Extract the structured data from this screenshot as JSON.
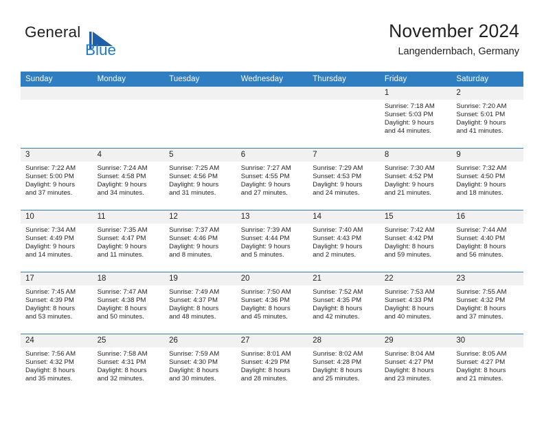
{
  "brand": {
    "name_part1": "General",
    "name_part2": "Blue",
    "mark_icon": "blue-triangle-flag-icon",
    "accent_color": "#1f7cc4"
  },
  "header": {
    "title": "November 2024",
    "subtitle": "Langendernbach, Germany"
  },
  "theme": {
    "header_row_color": "#2f7ec1",
    "daynum_band_color": "#f1f1f1",
    "text_color": "#231f20"
  },
  "calendar": {
    "weekday_headers": [
      "Sunday",
      "Monday",
      "Tuesday",
      "Wednesday",
      "Thursday",
      "Friday",
      "Saturday"
    ],
    "weeks": [
      [
        {
          "day": "",
          "lines": []
        },
        {
          "day": "",
          "lines": []
        },
        {
          "day": "",
          "lines": []
        },
        {
          "day": "",
          "lines": []
        },
        {
          "day": "",
          "lines": []
        },
        {
          "day": "1",
          "lines": [
            "Sunrise: 7:18 AM",
            "Sunset: 5:03 PM",
            "Daylight: 9 hours",
            "and 44 minutes."
          ]
        },
        {
          "day": "2",
          "lines": [
            "Sunrise: 7:20 AM",
            "Sunset: 5:01 PM",
            "Daylight: 9 hours",
            "and 41 minutes."
          ]
        }
      ],
      [
        {
          "day": "3",
          "lines": [
            "Sunrise: 7:22 AM",
            "Sunset: 5:00 PM",
            "Daylight: 9 hours",
            "and 37 minutes."
          ]
        },
        {
          "day": "4",
          "lines": [
            "Sunrise: 7:24 AM",
            "Sunset: 4:58 PM",
            "Daylight: 9 hours",
            "and 34 minutes."
          ]
        },
        {
          "day": "5",
          "lines": [
            "Sunrise: 7:25 AM",
            "Sunset: 4:56 PM",
            "Daylight: 9 hours",
            "and 31 minutes."
          ]
        },
        {
          "day": "6",
          "lines": [
            "Sunrise: 7:27 AM",
            "Sunset: 4:55 PM",
            "Daylight: 9 hours",
            "and 27 minutes."
          ]
        },
        {
          "day": "7",
          "lines": [
            "Sunrise: 7:29 AM",
            "Sunset: 4:53 PM",
            "Daylight: 9 hours",
            "and 24 minutes."
          ]
        },
        {
          "day": "8",
          "lines": [
            "Sunrise: 7:30 AM",
            "Sunset: 4:52 PM",
            "Daylight: 9 hours",
            "and 21 minutes."
          ]
        },
        {
          "day": "9",
          "lines": [
            "Sunrise: 7:32 AM",
            "Sunset: 4:50 PM",
            "Daylight: 9 hours",
            "and 18 minutes."
          ]
        }
      ],
      [
        {
          "day": "10",
          "lines": [
            "Sunrise: 7:34 AM",
            "Sunset: 4:49 PM",
            "Daylight: 9 hours",
            "and 14 minutes."
          ]
        },
        {
          "day": "11",
          "lines": [
            "Sunrise: 7:35 AM",
            "Sunset: 4:47 PM",
            "Daylight: 9 hours",
            "and 11 minutes."
          ]
        },
        {
          "day": "12",
          "lines": [
            "Sunrise: 7:37 AM",
            "Sunset: 4:46 PM",
            "Daylight: 9 hours",
            "and 8 minutes."
          ]
        },
        {
          "day": "13",
          "lines": [
            "Sunrise: 7:39 AM",
            "Sunset: 4:44 PM",
            "Daylight: 9 hours",
            "and 5 minutes."
          ]
        },
        {
          "day": "14",
          "lines": [
            "Sunrise: 7:40 AM",
            "Sunset: 4:43 PM",
            "Daylight: 9 hours",
            "and 2 minutes."
          ]
        },
        {
          "day": "15",
          "lines": [
            "Sunrise: 7:42 AM",
            "Sunset: 4:42 PM",
            "Daylight: 8 hours",
            "and 59 minutes."
          ]
        },
        {
          "day": "16",
          "lines": [
            "Sunrise: 7:44 AM",
            "Sunset: 4:40 PM",
            "Daylight: 8 hours",
            "and 56 minutes."
          ]
        }
      ],
      [
        {
          "day": "17",
          "lines": [
            "Sunrise: 7:45 AM",
            "Sunset: 4:39 PM",
            "Daylight: 8 hours",
            "and 53 minutes."
          ]
        },
        {
          "day": "18",
          "lines": [
            "Sunrise: 7:47 AM",
            "Sunset: 4:38 PM",
            "Daylight: 8 hours",
            "and 50 minutes."
          ]
        },
        {
          "day": "19",
          "lines": [
            "Sunrise: 7:49 AM",
            "Sunset: 4:37 PM",
            "Daylight: 8 hours",
            "and 48 minutes."
          ]
        },
        {
          "day": "20",
          "lines": [
            "Sunrise: 7:50 AM",
            "Sunset: 4:36 PM",
            "Daylight: 8 hours",
            "and 45 minutes."
          ]
        },
        {
          "day": "21",
          "lines": [
            "Sunrise: 7:52 AM",
            "Sunset: 4:35 PM",
            "Daylight: 8 hours",
            "and 42 minutes."
          ]
        },
        {
          "day": "22",
          "lines": [
            "Sunrise: 7:53 AM",
            "Sunset: 4:33 PM",
            "Daylight: 8 hours",
            "and 40 minutes."
          ]
        },
        {
          "day": "23",
          "lines": [
            "Sunrise: 7:55 AM",
            "Sunset: 4:32 PM",
            "Daylight: 8 hours",
            "and 37 minutes."
          ]
        }
      ],
      [
        {
          "day": "24",
          "lines": [
            "Sunrise: 7:56 AM",
            "Sunset: 4:32 PM",
            "Daylight: 8 hours",
            "and 35 minutes."
          ]
        },
        {
          "day": "25",
          "lines": [
            "Sunrise: 7:58 AM",
            "Sunset: 4:31 PM",
            "Daylight: 8 hours",
            "and 32 minutes."
          ]
        },
        {
          "day": "26",
          "lines": [
            "Sunrise: 7:59 AM",
            "Sunset: 4:30 PM",
            "Daylight: 8 hours",
            "and 30 minutes."
          ]
        },
        {
          "day": "27",
          "lines": [
            "Sunrise: 8:01 AM",
            "Sunset: 4:29 PM",
            "Daylight: 8 hours",
            "and 28 minutes."
          ]
        },
        {
          "day": "28",
          "lines": [
            "Sunrise: 8:02 AM",
            "Sunset: 4:28 PM",
            "Daylight: 8 hours",
            "and 25 minutes."
          ]
        },
        {
          "day": "29",
          "lines": [
            "Sunrise: 8:04 AM",
            "Sunset: 4:27 PM",
            "Daylight: 8 hours",
            "and 23 minutes."
          ]
        },
        {
          "day": "30",
          "lines": [
            "Sunrise: 8:05 AM",
            "Sunset: 4:27 PM",
            "Daylight: 8 hours",
            "and 21 minutes."
          ]
        }
      ]
    ]
  }
}
